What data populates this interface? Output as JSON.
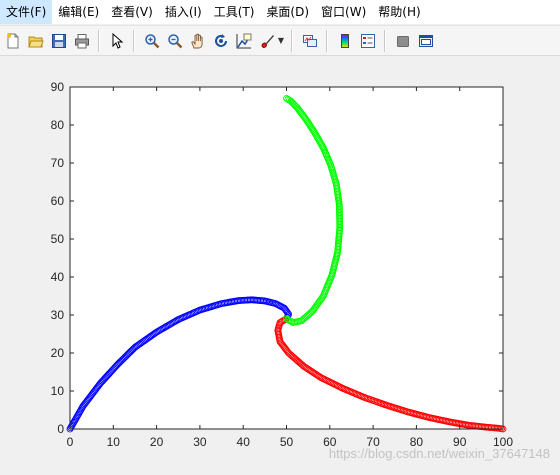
{
  "menu": [
    "文件(F)",
    "编辑(E)",
    "查看(V)",
    "插入(I)",
    "工具(T)",
    "桌面(D)",
    "窗口(W)",
    "帮助(H)"
  ],
  "toolbar": [
    {
      "icon": "new-file-icon"
    },
    {
      "icon": "open-folder-icon"
    },
    {
      "icon": "save-icon"
    },
    {
      "icon": "print-icon"
    },
    {
      "sep": true
    },
    {
      "icon": "pointer-arrow-icon"
    },
    {
      "sep": true
    },
    {
      "icon": "zoom-in-icon"
    },
    {
      "icon": "zoom-out-icon"
    },
    {
      "icon": "pan-hand-icon"
    },
    {
      "icon": "rotate-3d-icon"
    },
    {
      "icon": "data-cursor-icon"
    },
    {
      "icon": "brush-icon",
      "dropdown": true
    },
    {
      "sep": true
    },
    {
      "icon": "link-plot-icon"
    },
    {
      "sep": true
    },
    {
      "icon": "colorbar-icon"
    },
    {
      "icon": "legend-icon"
    },
    {
      "sep": true
    },
    {
      "icon": "hide-plot-tools-icon"
    },
    {
      "icon": "show-plot-tools-icon"
    }
  ],
  "watermark": "https://blog.csdn.net/weixin_37647148",
  "chart_data": {
    "type": "scatter",
    "title": "",
    "xlabel": "",
    "ylabel": "",
    "xlim": [
      0,
      100
    ],
    "ylim": [
      0,
      90
    ],
    "xticks": [
      0,
      10,
      20,
      30,
      40,
      50,
      60,
      70,
      80,
      90,
      100
    ],
    "yticks": [
      0,
      10,
      20,
      30,
      40,
      50,
      60,
      70,
      80,
      90
    ],
    "grid": false,
    "marker": "circle",
    "series": [
      {
        "color": "#0000ff",
        "x": [
          0,
          3,
          7,
          11,
          15,
          20,
          25,
          30,
          35,
          39,
          42,
          45,
          47.5,
          49.5,
          50.5,
          50
        ],
        "y": [
          0,
          6,
          12,
          17,
          21.5,
          25.5,
          28.8,
          31.3,
          33,
          33.8,
          34,
          33.7,
          33,
          31.8,
          30.2,
          29
        ]
      },
      {
        "color": "#ff0000",
        "x": [
          50,
          48.5,
          48,
          48.5,
          50.5,
          54,
          58,
          63,
          68,
          73,
          78,
          83,
          88,
          92,
          96,
          99,
          100
        ],
        "y": [
          29,
          28,
          26,
          23,
          20,
          16.5,
          13.5,
          10.7,
          8.3,
          6.3,
          4.5,
          3,
          1.8,
          1,
          0.5,
          0.2,
          0
        ]
      },
      {
        "color": "#00ff00",
        "x": [
          50,
          51.5,
          53.5,
          56,
          58.5,
          60.5,
          61.8,
          62.3,
          62.2,
          61.5,
          60.2,
          58.5,
          56.5,
          54.5,
          52.5,
          51,
          50
        ],
        "y": [
          29,
          28,
          28.5,
          31,
          35,
          40.5,
          46.5,
          53,
          59,
          64.5,
          69.5,
          74,
          78,
          81.5,
          84.5,
          86.3,
          87
        ]
      }
    ]
  }
}
